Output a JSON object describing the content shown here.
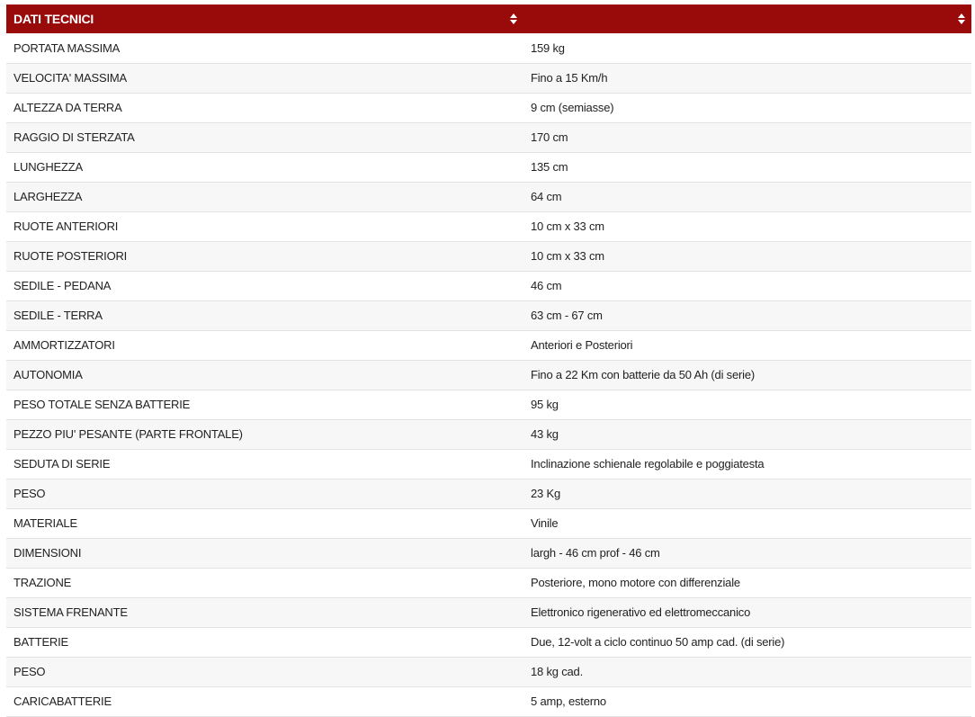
{
  "table": {
    "headers": [
      "DATI TECNICI",
      ""
    ],
    "rows": [
      [
        "PORTATA MASSIMA",
        "159 kg"
      ],
      [
        "VELOCITA' MASSIMA",
        "Fino a 15 Km/h"
      ],
      [
        "ALTEZZA DA TERRA",
        "9 cm (semiasse)"
      ],
      [
        "RAGGIO DI STERZATA",
        "170 cm"
      ],
      [
        "LUNGHEZZA",
        "135 cm"
      ],
      [
        "LARGHEZZA",
        "64 cm"
      ],
      [
        "RUOTE ANTERIORI",
        "10 cm x 33 cm"
      ],
      [
        "RUOTE POSTERIORI",
        "10 cm x 33 cm"
      ],
      [
        "SEDILE - PEDANA",
        "46 cm"
      ],
      [
        "SEDILE - TERRA",
        "63 cm - 67 cm"
      ],
      [
        "AMMORTIZZATORI",
        "Anteriori e Posteriori"
      ],
      [
        "AUTONOMIA",
        "Fino a 22 Km con batterie da 50 Ah (di serie)"
      ],
      [
        "PESO TOTALE SENZA BATTERIE",
        "95 kg"
      ],
      [
        "PEZZO PIU' PESANTE (PARTE FRONTALE)",
        "43 kg"
      ],
      [
        "SEDUTA DI SERIE",
        "Inclinazione schienale regolabile e poggiatesta"
      ],
      [
        "PESO",
        "23 Kg"
      ],
      [
        "MATERIALE",
        "Vinile"
      ],
      [
        "DIMENSIONI",
        "largh - 46 cm prof - 46 cm"
      ],
      [
        "TRAZIONE",
        "Posteriore, mono motore con differenziale"
      ],
      [
        "SISTEMA FRENANTE",
        "Elettronico rigenerativo ed elettromeccanico"
      ],
      [
        "BATTERIE",
        "Due, 12-volt a ciclo continuo 50 amp cad. (di serie)"
      ],
      [
        "PESO",
        "18 kg cad."
      ],
      [
        "CARICABATTERIE",
        "5 amp, esterno"
      ]
    ]
  },
  "colors": {
    "header_bg": "#990a0a",
    "header_text": "#ffffff",
    "row_alt_bg": "#f7f7f7",
    "row_border": "#e3e3e3"
  },
  "icons": {
    "sort": "sort-arrows-icon"
  }
}
